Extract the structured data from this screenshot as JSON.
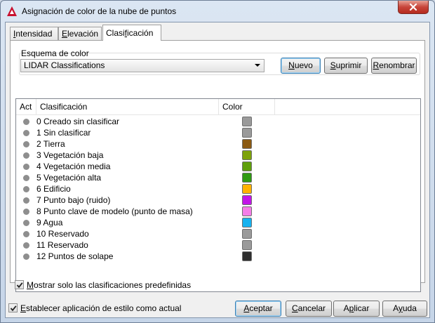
{
  "window": {
    "title": "Asignación de color de la nube de puntos"
  },
  "tabs": [
    {
      "label_pre": "",
      "label_ul": "I",
      "label_post": "ntensidad"
    },
    {
      "label_pre": "",
      "label_ul": "E",
      "label_post": "levación"
    },
    {
      "label_pre": "Clasi",
      "label_ul": "f",
      "label_post": "icación"
    }
  ],
  "color_scheme": {
    "group_label": "Esquema de color",
    "selected": "LIDAR Classifications",
    "new_button": {
      "pre": "",
      "ul": "N",
      "post": "uevo"
    },
    "delete_button": {
      "pre": "",
      "ul": "S",
      "post": "uprimir"
    },
    "rename_button": {
      "pre": "",
      "ul": "R",
      "post": "enombrar"
    }
  },
  "table": {
    "headers": {
      "act": "Act",
      "classification": "Clasificación",
      "color": "Color"
    },
    "rows": [
      {
        "label": "0 Creado sin clasificar",
        "color": "#9a9a9a"
      },
      {
        "label": "1 Sin clasificar",
        "color": "#9a9a9a"
      },
      {
        "label": "2 Tierra",
        "color": "#8b5a12"
      },
      {
        "label": "3 Vegetación baja",
        "color": "#7da20a"
      },
      {
        "label": "4 Vegetación media",
        "color": "#5f9f0b"
      },
      {
        "label": "5 Vegetación alta",
        "color": "#2f9a12"
      },
      {
        "label": "6 Edificio",
        "color": "#ffb300"
      },
      {
        "label": "7 Punto bajo (ruido)",
        "color": "#c214e8"
      },
      {
        "label": "8 Punto clave de modelo (punto de masa)",
        "color": "#f57de8"
      },
      {
        "label": "9 Agua",
        "color": "#16b2ef"
      },
      {
        "label": "10 Reservado",
        "color": "#9a9a9a"
      },
      {
        "label": "11 Reservado",
        "color": "#9a9a9a"
      },
      {
        "label": "12 Puntos de solape",
        "color": "#2f2f2f"
      }
    ]
  },
  "show_predefined": {
    "checked": true,
    "pre": "",
    "ul": "M",
    "post": "ostrar solo las clasificaciones predefinidas"
  },
  "set_current": {
    "checked": true,
    "pre": "",
    "ul": "E",
    "post": "stablecer aplicación de estilo como actual"
  },
  "footer": {
    "accept": {
      "pre": "",
      "ul": "A",
      "post": "ceptar"
    },
    "cancel": {
      "pre": "",
      "ul": "C",
      "post": "ancelar"
    },
    "apply": {
      "pre": "A",
      "ul": "p",
      "post": "licar"
    },
    "help": {
      "pre": "A",
      "ul": "y",
      "post": "uda"
    }
  }
}
